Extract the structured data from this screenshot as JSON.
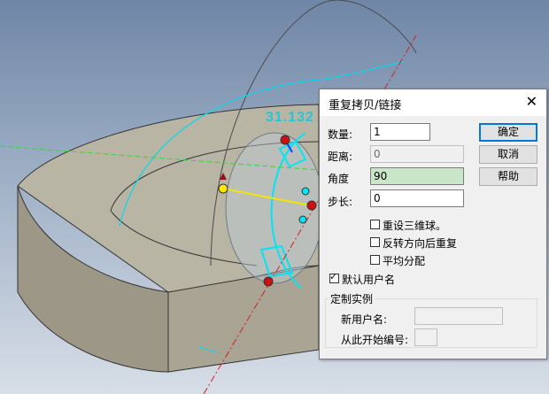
{
  "viewport": {
    "dimension_text": "31.132"
  },
  "dialog": {
    "title": "重复拷贝/链接",
    "close_glyph": "✕",
    "count_label": "数量:",
    "count_value": "1",
    "distance_label": "距离:",
    "distance_value": "0",
    "angle_label": "角度",
    "angle_value": "90",
    "step_label": "步长:",
    "step_value": "0",
    "ok_label": "确定",
    "cancel_label": "取消",
    "help_label": "帮助",
    "options": [
      {
        "label": "重设三维球。",
        "checked": false
      },
      {
        "label": "反转方向后重复",
        "checked": false
      },
      {
        "label": "平均分配",
        "checked": false
      }
    ],
    "default_name": {
      "label": "默认用户名",
      "checked": true
    },
    "custom_group": {
      "label": "定制实例",
      "new_name_label": "新用户名:",
      "new_name_value": "",
      "start_number_label": "从此开始编号:",
      "start_number_value": ""
    }
  },
  "colors": {
    "viewport_bg_top": "#6f86a6",
    "viewport_bg_bottom": "#d7dee7",
    "part_face": "#a9a493",
    "part_top": "#b9b5a5",
    "accent": "#00d9ee",
    "focus_border": "#0078d7",
    "highlight_field": "#c9e7c8"
  }
}
